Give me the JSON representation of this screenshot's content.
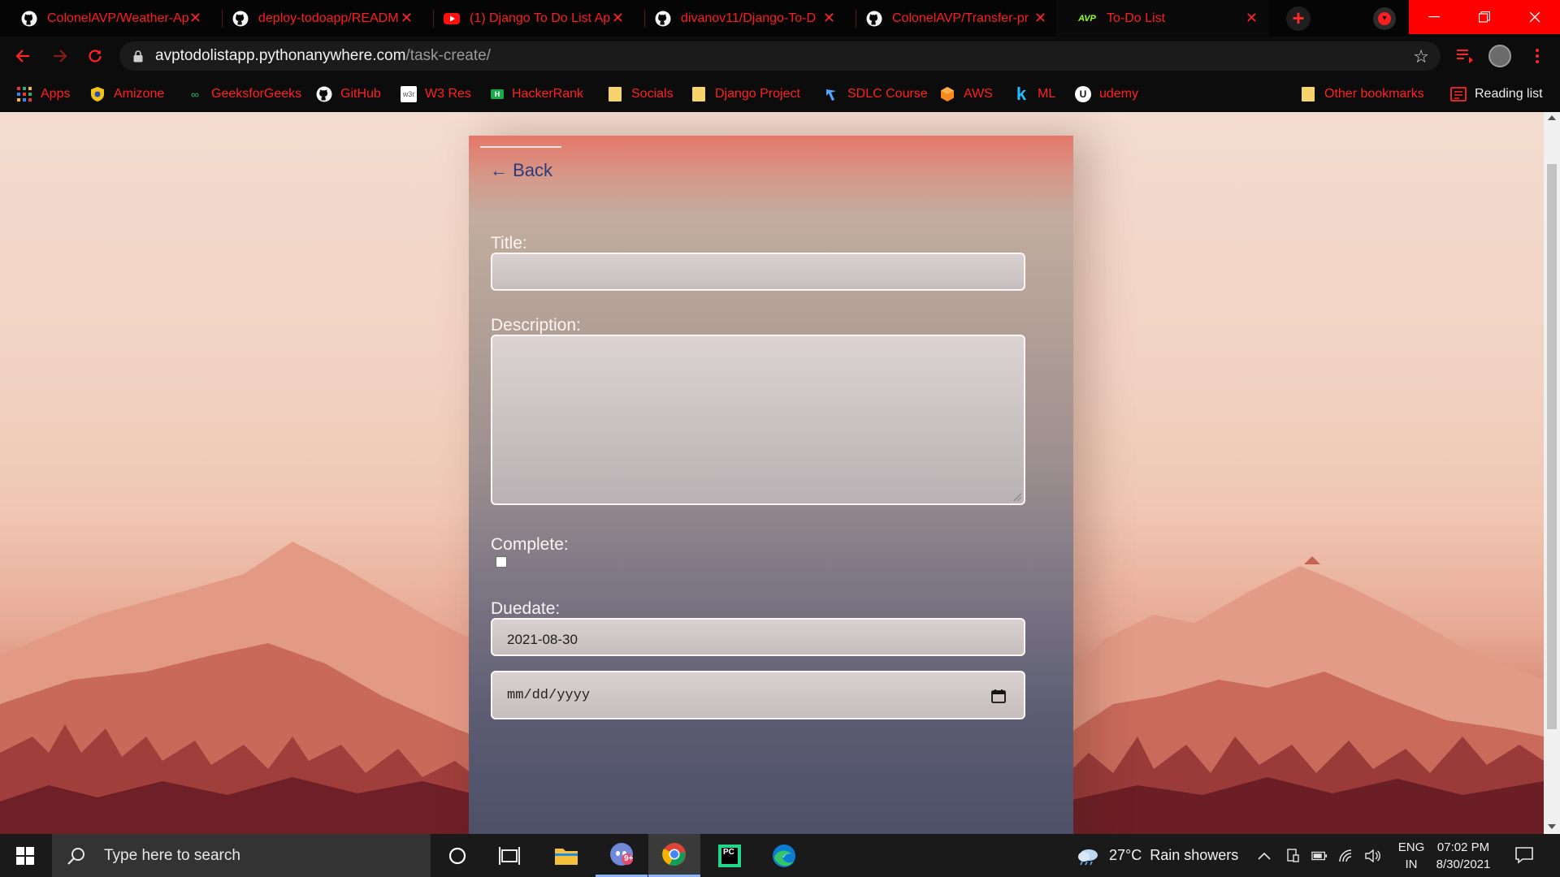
{
  "colors": {
    "tab_text": "#ff1d1d",
    "browser_bg": "#0c0c0c",
    "close_button": "#ff0000",
    "back_link": "#2b3c7a",
    "label": "#fbf4f2"
  },
  "tabs": [
    {
      "title": "ColonelAVP/Weather-Ap",
      "icon": "github-icon"
    },
    {
      "title": "deploy-todoapp/READM",
      "icon": "github-icon"
    },
    {
      "title": "(1) Django To Do List Ap",
      "icon": "youtube-icon"
    },
    {
      "title": "divanov11/Django-To-D",
      "icon": "github-icon"
    },
    {
      "title": "ColonelAVP/Transfer-pr",
      "icon": "github-icon"
    },
    {
      "title": "To-Do List",
      "icon": "avp-icon",
      "icon_text": "AVP",
      "active": true
    }
  ],
  "address": {
    "host": "avptodolistapp.pythonanywhere.com",
    "path": "/task-create/"
  },
  "bookmarks": [
    {
      "label": "Apps",
      "icon": "apps-grid-icon"
    },
    {
      "label": "Amizone",
      "icon": "amizone-icon"
    },
    {
      "label": "GeeksforGeeks",
      "icon": "geeksforgeeks-icon"
    },
    {
      "label": "GitHub",
      "icon": "github-icon"
    },
    {
      "label": "W3 Res",
      "icon": "w3resource-icon",
      "icon_text": "w3r"
    },
    {
      "label": "HackerRank",
      "icon": "hackerrank-icon",
      "icon_text": "H"
    },
    {
      "label": "Socials",
      "icon": "folder-icon"
    },
    {
      "label": "Django Project",
      "icon": "folder-icon"
    },
    {
      "label": "SDLC Course",
      "icon": "sdlc-icon"
    },
    {
      "label": "AWS",
      "icon": "aws-icon"
    },
    {
      "label": "ML",
      "icon": "ml-icon",
      "icon_text": "k"
    },
    {
      "label": "udemy",
      "icon": "udemy-icon",
      "icon_text": "U"
    },
    {
      "label": "Other bookmarks",
      "icon": "folder-icon"
    },
    {
      "label": "Reading list",
      "icon": "reading-list-icon"
    }
  ],
  "form": {
    "back_label": "← Back",
    "title_label": "Title:",
    "title_value": "",
    "description_label": "Description:",
    "description_value": "",
    "complete_label": "Complete:",
    "complete_checked": false,
    "duedate_label": "Duedate:",
    "duedate_value": "2021-08-30",
    "date_placeholder": "mm/dd/yyyy"
  },
  "taskbar": {
    "search_placeholder": "Type here to search",
    "weather_temp": "27°C",
    "weather_desc": "Rain showers",
    "lang_line1": "ENG",
    "lang_line2": "IN",
    "time": "07:02 PM",
    "date": "8/30/2021",
    "apps": [
      "cortana-icon",
      "task-view-icon",
      "file-explorer-icon",
      "discord-icon",
      "chrome-icon",
      "pycharm-icon",
      "edge-icon"
    ],
    "discord_badge": "9+",
    "pycharm_label": "PC"
  }
}
